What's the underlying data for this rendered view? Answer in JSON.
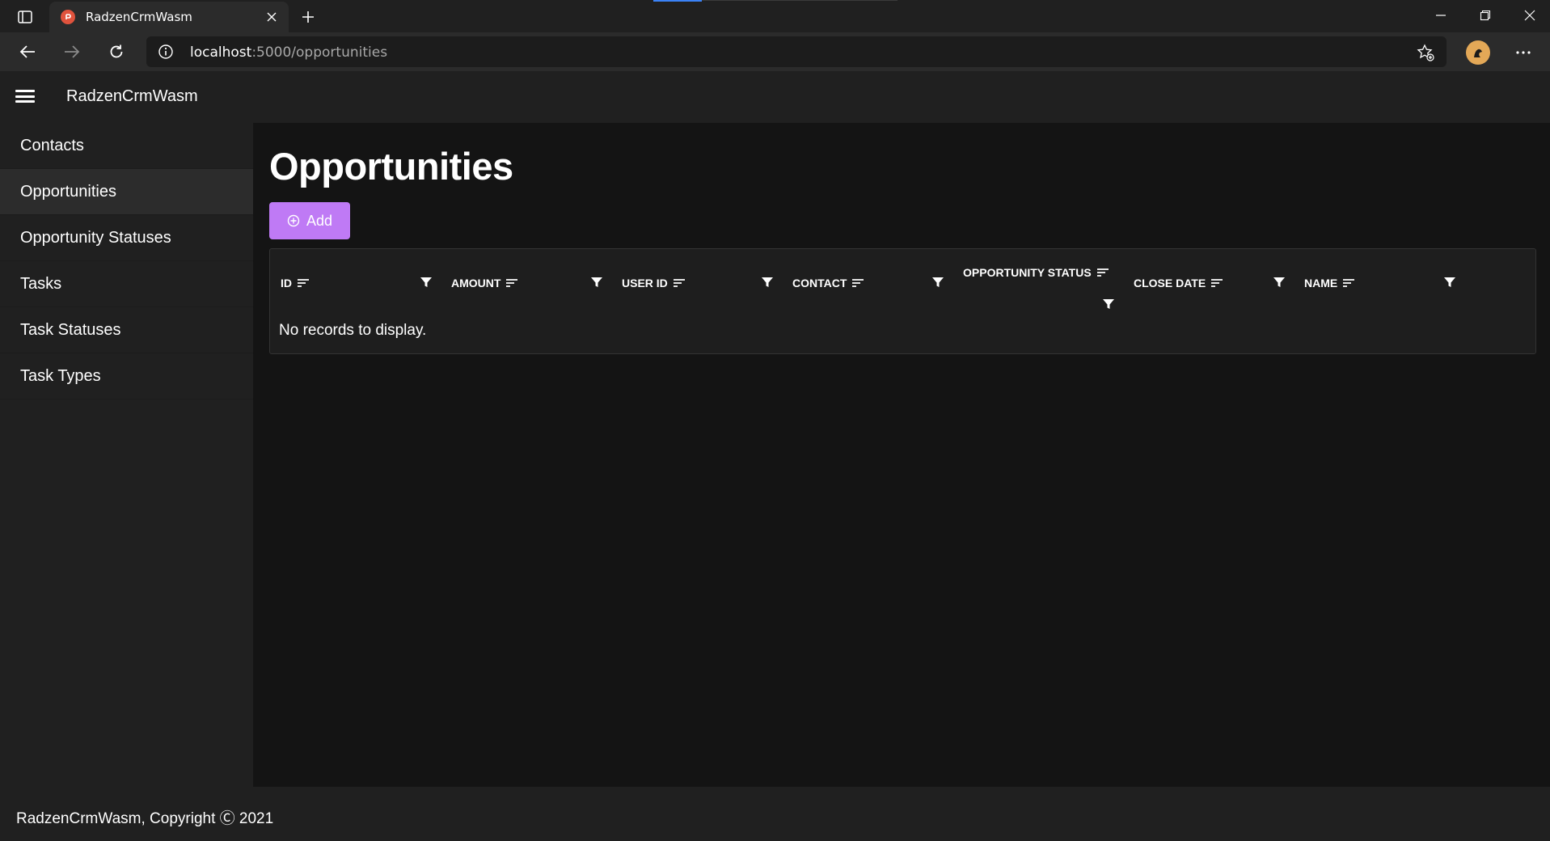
{
  "browser": {
    "tab_title": "RadzenCrmWasm",
    "url_host": "localhost",
    "url_path": ":5000/opportunities"
  },
  "app": {
    "title": "RadzenCrmWasm"
  },
  "sidebar": {
    "items": [
      {
        "label": "Contacts",
        "active": false
      },
      {
        "label": "Opportunities",
        "active": true
      },
      {
        "label": "Opportunity Statuses",
        "active": false
      },
      {
        "label": "Tasks",
        "active": false
      },
      {
        "label": "Task Statuses",
        "active": false
      },
      {
        "label": "Task Types",
        "active": false
      }
    ]
  },
  "main": {
    "title": "Opportunities",
    "add_label": "Add",
    "columns": [
      "ID",
      "AMOUNT",
      "USER ID",
      "CONTACT",
      "OPPORTUNITY STATUS",
      "CLOSE DATE",
      "NAME"
    ],
    "empty_message": "No records to display."
  },
  "footer": {
    "text": "RadzenCrmWasm, Copyright Ⓒ 2021"
  },
  "colors": {
    "accent": "#bf7af5",
    "background": "#141414",
    "panel": "#202020"
  }
}
